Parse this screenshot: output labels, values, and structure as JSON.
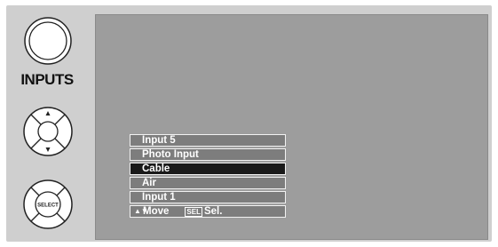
{
  "remote": {
    "inputs_label": "INPUTS",
    "select_label": "SELECT",
    "icons": [
      "inputs-button-icon",
      "dpad-up-icon",
      "dpad-down-icon",
      "select-button-icon"
    ]
  },
  "menu": {
    "items": [
      {
        "label": "Input 5",
        "selected": false
      },
      {
        "label": "Photo Input",
        "selected": false
      },
      {
        "label": "Cable",
        "selected": true
      },
      {
        "label": "Air",
        "selected": false
      },
      {
        "label": "Input 1",
        "selected": false
      }
    ],
    "footer": {
      "arrows": "▲▼",
      "move_label": "Move",
      "sel_key": "SEL",
      "sel_label": "Sel."
    }
  },
  "colors": {
    "panel": "#cfcfcf",
    "screen": "#9d9d9d",
    "menu_item": "#7d7d7d",
    "menu_selected": "#1a1a1a"
  }
}
